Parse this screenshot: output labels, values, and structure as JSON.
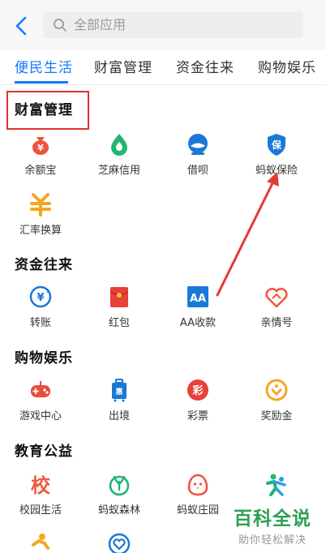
{
  "search": {
    "placeholder": "全部应用"
  },
  "tabs": [
    "便民生活",
    "财富管理",
    "资金往来",
    "购物娱乐"
  ],
  "sections": [
    {
      "title": "财富管理",
      "apps": [
        {
          "label": "余额宝",
          "icon": "money-bag-icon",
          "color": "#f0533b"
        },
        {
          "label": "芝麻信用",
          "icon": "sesame-credit-icon",
          "color": "#22b573"
        },
        {
          "label": "借呗",
          "icon": "jiebei-icon",
          "color": "#1a78d6"
        },
        {
          "label": "蚂蚁保险",
          "icon": "insurance-shield-icon",
          "color": "#1a78d6"
        },
        {
          "label": "汇率换算",
          "icon": "exchange-rate-icon",
          "color": "#f5a623"
        }
      ]
    },
    {
      "title": "资金往来",
      "apps": [
        {
          "label": "转账",
          "icon": "transfer-icon",
          "color": "#1a78d6"
        },
        {
          "label": "红包",
          "icon": "red-envelope-icon",
          "color": "#e8403a"
        },
        {
          "label": "AA收款",
          "icon": "aa-collect-icon",
          "color": "#1a78d6"
        },
        {
          "label": "亲情号",
          "icon": "family-heart-icon",
          "color": "#ef5a3d"
        }
      ]
    },
    {
      "title": "购物娱乐",
      "apps": [
        {
          "label": "游戏中心",
          "icon": "game-controller-icon",
          "color": "#e84c3d"
        },
        {
          "label": "出境",
          "icon": "suitcase-icon",
          "color": "#1a78d6"
        },
        {
          "label": "彩票",
          "icon": "lottery-icon",
          "color": "#e8403a"
        },
        {
          "label": "奖励金",
          "icon": "reward-coin-icon",
          "color": "#f5a623"
        }
      ]
    },
    {
      "title": "教育公益",
      "apps": [
        {
          "label": "校园生活",
          "icon": "campus-icon",
          "color": "#ef5a3d"
        },
        {
          "label": "蚂蚁森林",
          "icon": "ant-forest-icon",
          "color": "#22b573"
        },
        {
          "label": "蚂蚁庄园",
          "icon": "ant-farm-chick-icon",
          "color": "#f0533b"
        }
      ]
    }
  ],
  "watermark": {
    "title": "百科全说",
    "subtitle": "助你轻松解决"
  },
  "colors": {
    "accent": "#1677ff",
    "highlight_box": "#e0312f",
    "watermark": "#2e9f53"
  }
}
